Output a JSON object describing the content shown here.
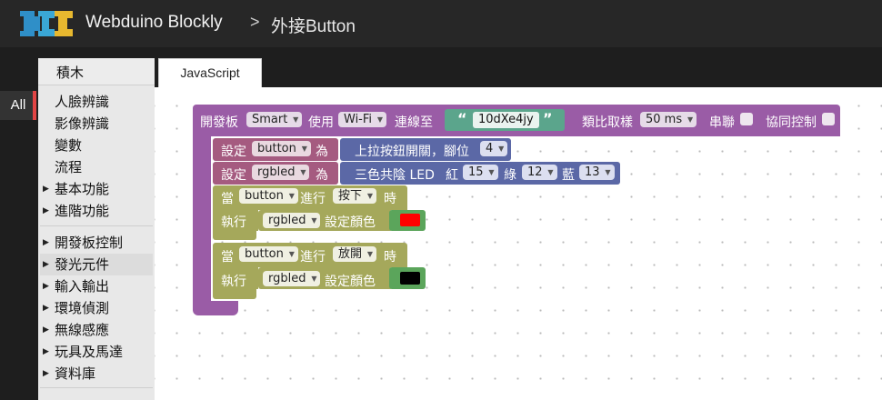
{
  "header": {
    "app_title": "Webduino Blockly",
    "separator": ">",
    "project_title": "外接Button"
  },
  "tabs": {
    "javascript": "JavaScript"
  },
  "sidebar": {
    "all_label": "All"
  },
  "toolbox": {
    "header": "積木",
    "items": [
      {
        "label": "人臉辨識",
        "arrow": ""
      },
      {
        "label": "影像辨識",
        "arrow": ""
      },
      {
        "label": "變數",
        "arrow": ""
      },
      {
        "label": "流程",
        "arrow": ""
      },
      {
        "label": "基本功能",
        "arrow": "▶"
      },
      {
        "label": "進階功能",
        "arrow": "▶"
      },
      {
        "label": "開發板控制",
        "arrow": "▶"
      },
      {
        "label": "發光元件",
        "arrow": "▶"
      },
      {
        "label": "輸入輸出",
        "arrow": "▶"
      },
      {
        "label": "環境偵測",
        "arrow": "▶"
      },
      {
        "label": "無線感應",
        "arrow": "▶"
      },
      {
        "label": "玩具及馬達",
        "arrow": "▶"
      },
      {
        "label": "資料庫",
        "arrow": "▶"
      }
    ]
  },
  "blocks": {
    "board": {
      "label_board": "開發板",
      "board_type": "Smart",
      "label_use": "使用",
      "connection": "Wi-Fi",
      "label_connect": "連線至",
      "device_id": "10dXe4jy",
      "label_sampling": "類比取樣",
      "sampling": "50 ms",
      "label_serial": "串聯",
      "label_sync": "協同控制"
    },
    "set_button": {
      "label_set": "設定",
      "var": "button",
      "label_as": "為",
      "desc": "上拉按鈕開關，腳位",
      "pin": "4"
    },
    "set_rgbled": {
      "label_set": "設定",
      "var": "rgbled",
      "label_as": "為",
      "desc": "三色共陰 LED",
      "label_red": "紅",
      "red": "15",
      "label_green": "綠",
      "green": "12",
      "label_blue": "藍",
      "blue": "13"
    },
    "event_press": {
      "label_when": "當",
      "var": "button",
      "label_do": "進行",
      "action": "按下",
      "label_time": "時",
      "label_exec": "執行",
      "target": "rgbled",
      "label_setcolor": "設定顏色",
      "color": "#ff0000"
    },
    "event_release": {
      "label_when": "當",
      "var": "button",
      "label_do": "進行",
      "action": "放開",
      "label_time": "時",
      "label_exec": "執行",
      "target": "rgbled",
      "label_setcolor": "設定顏色",
      "color": "#000000"
    }
  }
}
